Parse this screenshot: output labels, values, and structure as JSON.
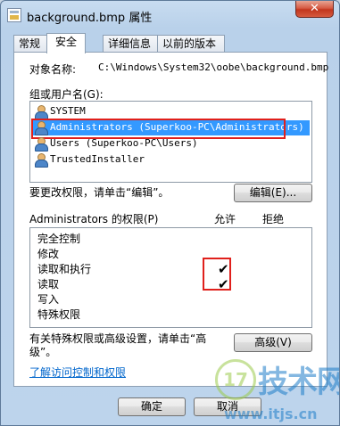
{
  "window": {
    "title": "background.bmp 属性",
    "close_label": "✕"
  },
  "tabs": [
    {
      "label": "常规"
    },
    {
      "label": "安全"
    },
    {
      "label": "详细信息"
    },
    {
      "label": "以前的版本"
    }
  ],
  "object": {
    "label": "对象名称:",
    "value": "C:\\Windows\\System32\\oobe\\background.bmp"
  },
  "groups": {
    "label": "组或用户名(G):",
    "items": [
      {
        "name": "SYSTEM",
        "icon": "users-icon"
      },
      {
        "name": "Administrators (Superkoo-PC\\Administrators)",
        "icon": "users-icon",
        "selected": true
      },
      {
        "name": "Users (Superkoo-PC\\Users)",
        "icon": "users-icon"
      },
      {
        "name": "TrustedInstaller",
        "icon": "users-icon"
      }
    ]
  },
  "change": {
    "text": "要更改权限，请单击“编辑”。",
    "edit_button": "编辑(E)..."
  },
  "permissions": {
    "title": "Administrators 的权限(P)",
    "allow_header": "允许",
    "deny_header": "拒绝",
    "rows": [
      {
        "name": "完全控制",
        "allow": false,
        "deny": false
      },
      {
        "name": "修改",
        "allow": false,
        "deny": false
      },
      {
        "name": "读取和执行",
        "allow": true,
        "deny": false
      },
      {
        "name": "读取",
        "allow": true,
        "deny": false
      },
      {
        "name": "写入",
        "allow": false,
        "deny": false
      },
      {
        "name": "特殊权限",
        "allow": false,
        "deny": false
      }
    ],
    "check_glyph": "✔"
  },
  "special": {
    "text": "有关特殊权限或高级设置，请单击“高级”。",
    "advanced_button": "高级(V)"
  },
  "link": {
    "text": "了解访问控制和权限"
  },
  "footer": {
    "ok_label": "确定",
    "cancel_label": "取消"
  },
  "watermark": {
    "badge": "17",
    "brand": "技术网",
    "url": "www.itjs.cn"
  },
  "colors": {
    "selection": "#3399ff",
    "highlight_border": "#e0201c",
    "link": "#0066cc"
  }
}
